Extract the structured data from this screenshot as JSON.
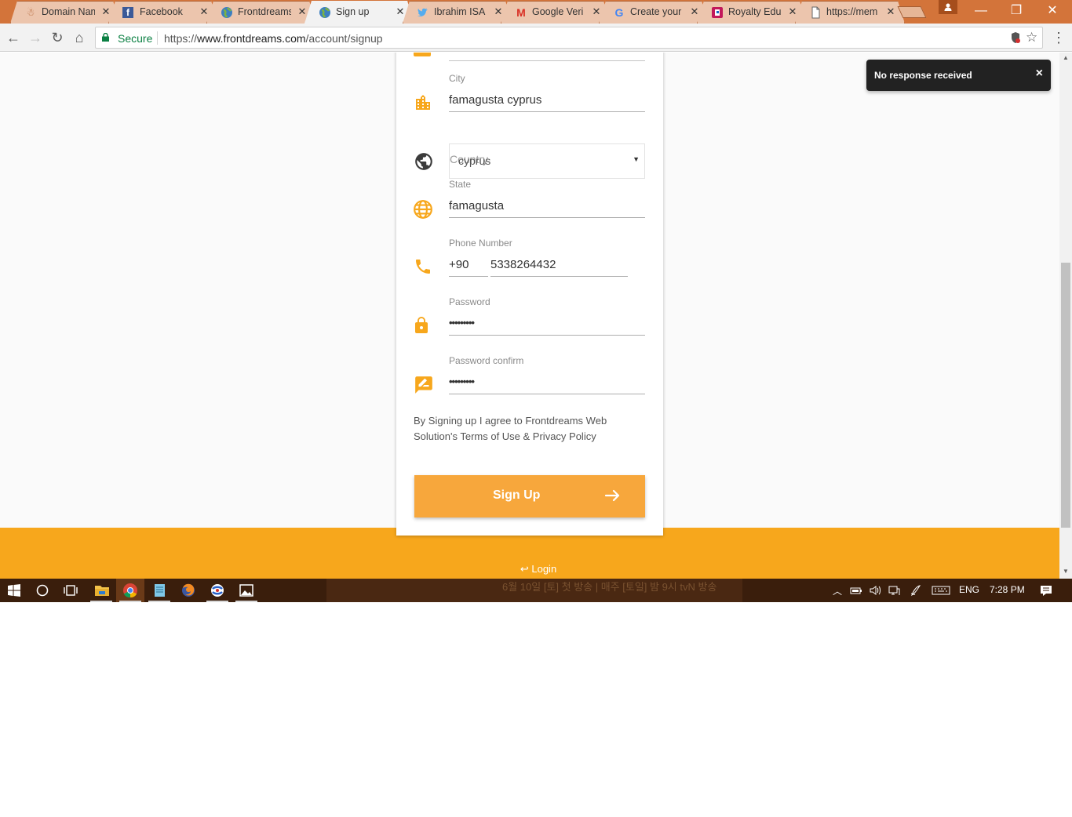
{
  "browser": {
    "tabs": [
      {
        "title": "Domain Nam",
        "icon": "domain-icon",
        "active": false
      },
      {
        "title": "Facebook",
        "icon": "facebook-icon",
        "active": false
      },
      {
        "title": "Frontdreams",
        "icon": "globe-icon",
        "active": false
      },
      {
        "title": "Sign up",
        "icon": "globe-icon",
        "active": true
      },
      {
        "title": "Ibrahim ISA",
        "icon": "twitter-icon",
        "active": false
      },
      {
        "title": "Google Veri",
        "icon": "gmail-icon",
        "active": false
      },
      {
        "title": "Create your",
        "icon": "google-icon",
        "active": false
      },
      {
        "title": "Royalty Edu",
        "icon": "royalty-icon",
        "active": false
      },
      {
        "title": "https://mem",
        "icon": "page-icon",
        "active": false
      }
    ],
    "tab_close_glyph": "✕",
    "secure_label": "Secure",
    "url_scheme": "https://",
    "url_host": "www.frontdreams.com",
    "url_path": "/account/signup"
  },
  "form": {
    "city": {
      "label": "City",
      "value": "famagusta cyprus"
    },
    "country": {
      "label": "Country",
      "value": "cyprus"
    },
    "state": {
      "label": "State",
      "value": "famagusta"
    },
    "phone": {
      "label": "Phone Number",
      "code": "+90",
      "number": "5338264432"
    },
    "password": {
      "label": "Password",
      "value": "•••••••••"
    },
    "password_confirm": {
      "label": "Password confirm",
      "value": "•••••••••"
    },
    "terms_text": "By Signing up I agree to Frontdreams Web Solution's Terms of Use & Privacy Policy",
    "submit_label": "Sign Up",
    "login_link": "Login"
  },
  "toast": {
    "message": "No response received",
    "close": "×"
  },
  "taskbar": {
    "banner_text": "6월 10일 [토] 첫 방송 | 매주 [토일] 밤 9시 tvN 방송",
    "language": "ENG",
    "time": "7:28 PM"
  },
  "colors": {
    "accent": "#f7a71c",
    "button": "#f7a73c",
    "tabstrip": "#d3743a",
    "taskbar": "#3a1e0c"
  }
}
